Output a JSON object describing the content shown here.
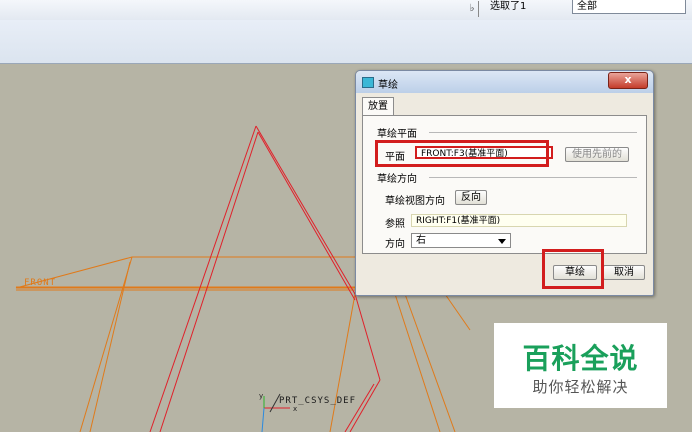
{
  "toolbar": {
    "selection_status": "选取了1",
    "filter_value": "全部"
  },
  "viewport": {
    "front_plane_label": "FRONT",
    "csys_label": "PRT_CSYS_DEF",
    "csys_axis_x": "x",
    "csys_axis_y": "y"
  },
  "dialog": {
    "title": "草绘",
    "close_label": "x",
    "tab_label": "放置",
    "sketch_plane_section": "草绘平面",
    "plane_label": "平面",
    "plane_value": "FRONT:F3(基准平面)",
    "use_previous_button": "使用先前的",
    "orientation_section": "草绘方向",
    "view_direction_label": "草绘视图方向",
    "flip_button": "反向",
    "reference_label": "参照",
    "reference_value": "RIGHT:F1(基准平面)",
    "direction_label": "方向",
    "direction_value": "右",
    "sketch_button": "草绘",
    "cancel_button": "取消"
  },
  "watermark": {
    "title": "百科全说",
    "subtitle": "助你轻松解决"
  },
  "colors": {
    "plane_orange": "#e07a1a",
    "selected_red": "#e0202a",
    "highlight_red": "#d21d1d",
    "watermark_green": "#1aa05b"
  }
}
